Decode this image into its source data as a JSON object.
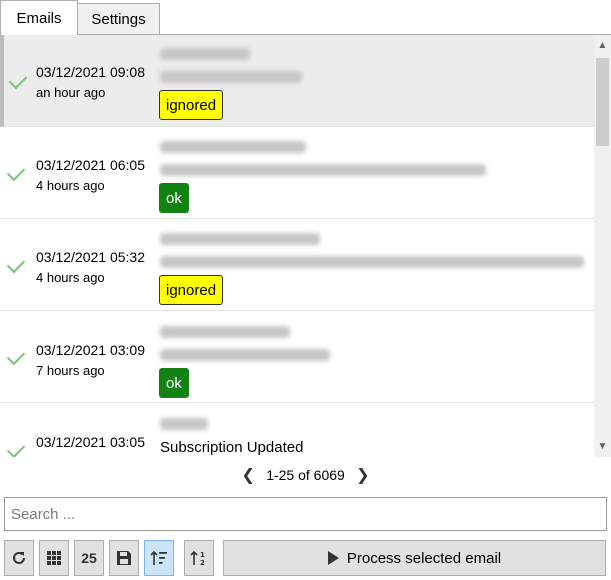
{
  "tabs": [
    {
      "label": "Emails",
      "active": true
    },
    {
      "label": "Settings",
      "active": false
    }
  ],
  "emails": [
    {
      "date": "03/12/2021 09:08",
      "ago": "an hour ago",
      "status": "ignored",
      "subject": "",
      "selected": true
    },
    {
      "date": "03/12/2021 06:05",
      "ago": "4 hours ago",
      "status": "ok",
      "subject": "",
      "selected": false
    },
    {
      "date": "03/12/2021 05:32",
      "ago": "4 hours ago",
      "status": "ignored",
      "subject": "",
      "selected": false
    },
    {
      "date": "03/12/2021 03:09",
      "ago": "7 hours ago",
      "status": "ok",
      "subject": "",
      "selected": false
    },
    {
      "date": "03/12/2021 03:05",
      "ago": "",
      "status": "",
      "subject": "Subscription Updated",
      "selected": false
    }
  ],
  "pager": {
    "range": "1-25 of 6069"
  },
  "search": {
    "placeholder": "Search ..."
  },
  "toolbar": {
    "page_size_label": "25",
    "process_label": "Process selected email"
  },
  "icons": {
    "check": "check-icon",
    "refresh": "refresh-icon",
    "grid": "grid-icon",
    "save": "save-icon",
    "sort_desc": "sort-descending-icon",
    "sort_num": "sort-numeric-icon",
    "play": "play-icon",
    "prev": "chevron-left-icon",
    "next": "chevron-right-icon"
  },
  "colors": {
    "ignored": "#ffff00",
    "ok": "#128212",
    "check": "#7ac37a",
    "active_button": "#cce4f7"
  }
}
